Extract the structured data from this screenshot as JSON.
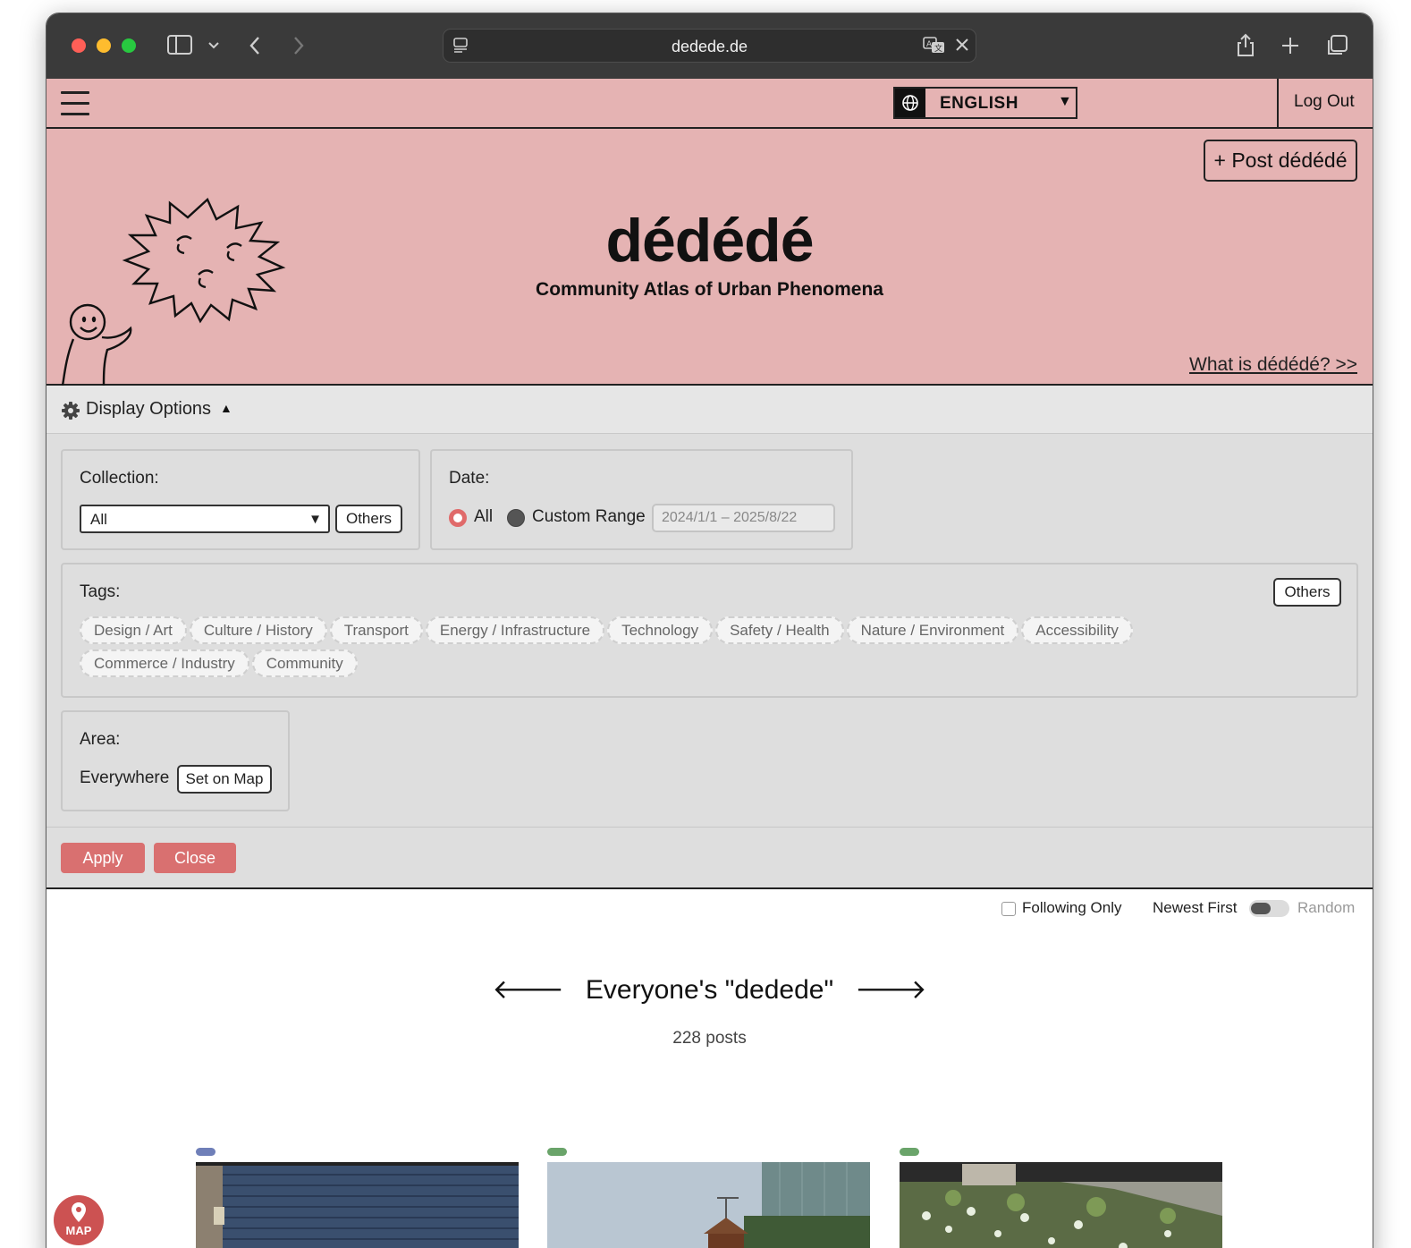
{
  "browser": {
    "url": "dedede.de"
  },
  "header": {
    "language": "ENGLISH",
    "logout_label": "Log Out"
  },
  "hero": {
    "post_button": "+ Post dédédé",
    "title": "dédédé",
    "subtitle": "Community Atlas of Urban Phenomena",
    "about_link": "What is dédédé? >>"
  },
  "display_options": {
    "label": "Display Options",
    "collection": {
      "title": "Collection:",
      "selected": "All",
      "others_label": "Others"
    },
    "date": {
      "title": "Date:",
      "option_all": "All",
      "option_custom": "Custom Range",
      "range_placeholder": "2024/1/1 – 2025/8/22"
    },
    "tags": {
      "title": "Tags:",
      "others_label": "Others",
      "items": [
        "Design / Art",
        "Culture / History",
        "Transport",
        "Energy / Infrastructure",
        "Technology",
        "Safety / Health",
        "Nature / Environment",
        "Accessibility",
        "Commerce / Industry",
        "Community"
      ]
    },
    "area": {
      "title": "Area:",
      "value": "Everywhere",
      "set_on_map_label": "Set on Map"
    },
    "apply_label": "Apply",
    "close_label": "Close"
  },
  "feed": {
    "following_only": "Following Only",
    "newest_first": "Newest First",
    "random": "Random",
    "section_title": "Everyone's \"dedede\"",
    "post_count": "228 posts",
    "card_tag_colors": [
      "#6f7fb8",
      "#6aa46a",
      "#6aa46a"
    ]
  },
  "map_button_label": "MAP",
  "colors": {
    "brand_pink": "#e5b3b3",
    "accent_red": "#d97070"
  }
}
